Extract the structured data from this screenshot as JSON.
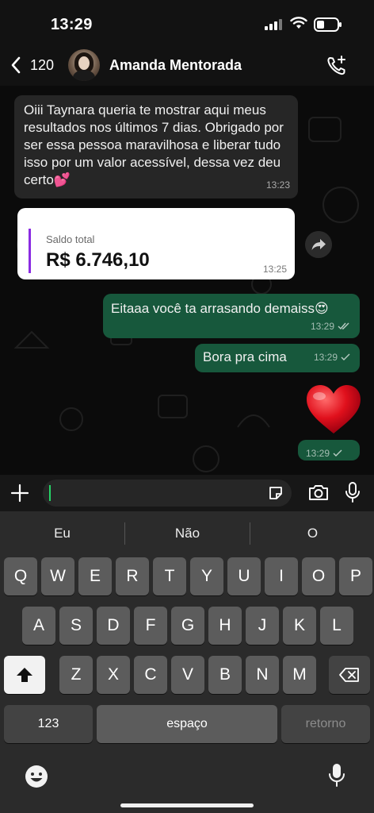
{
  "status_bar": {
    "time": "13:29"
  },
  "header": {
    "back_count": "120",
    "contact_name": "Amanda Mentorada",
    "icons": [
      "chevron-left-icon",
      "avatar",
      "add-call-icon"
    ]
  },
  "messages": [
    {
      "direction": "in",
      "text": "Oiii Taynara queria te mostrar aqui meus resultados nos últimos 7 dias. Obrigado por ser essa pessoa maravilhosa e liberar tudo isso por um valor acessível, dessa vez deu certo💕",
      "time": "13:23"
    },
    {
      "direction": "in",
      "type": "image",
      "card_label": "Saldo total",
      "card_value": "R$ 6.746,10",
      "time": "13:25"
    },
    {
      "direction": "out",
      "text": "Eitaaa você ta arrasando demaiss😍",
      "time": "13:29",
      "status": "read"
    },
    {
      "direction": "out",
      "text": "Bora pra cima",
      "time": "13:29",
      "status": "sent"
    },
    {
      "direction": "out",
      "type": "emoji",
      "text": "❤️",
      "time": "13:29",
      "status": "sent"
    }
  ],
  "input": {
    "placeholder": "",
    "icons": [
      "plus-icon",
      "sticker-icon",
      "camera-icon",
      "mic-icon"
    ]
  },
  "keyboard": {
    "suggestions": [
      "Eu",
      "Não",
      "O"
    ],
    "row1": [
      "Q",
      "W",
      "E",
      "R",
      "T",
      "Y",
      "U",
      "I",
      "O",
      "P"
    ],
    "row2": [
      "A",
      "S",
      "D",
      "F",
      "G",
      "H",
      "J",
      "K",
      "L"
    ],
    "row3": [
      "Z",
      "X",
      "C",
      "V",
      "B",
      "N",
      "M"
    ],
    "numbers_label": "123",
    "space_label": "espaço",
    "return_label": "retorno"
  },
  "colors": {
    "outgoing_bubble": "#17583c",
    "incoming_bubble": "#262626",
    "accent_green": "#25d366",
    "card_accent": "#8a2be2"
  }
}
